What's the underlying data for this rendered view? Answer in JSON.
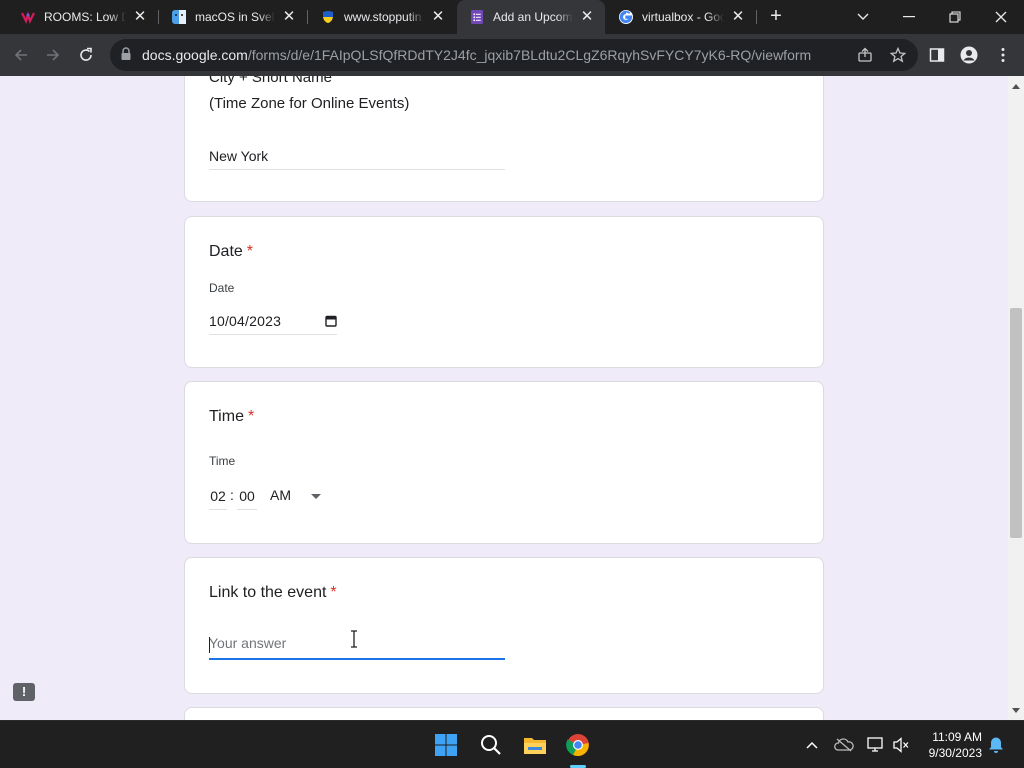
{
  "browser": {
    "tabs": [
      {
        "title": "ROOMS: Low De",
        "favicon": "rooms-logo-icon"
      },
      {
        "title": "macOS in Svelte",
        "favicon": "mac-finder-icon"
      },
      {
        "title": "www.stopputin.",
        "favicon": "ukraine-flag-icon"
      },
      {
        "title": "Add an Upcomi",
        "favicon": "google-forms-icon",
        "active": true
      },
      {
        "title": "virtualbox - Goo",
        "favicon": "google-g-icon"
      }
    ],
    "url_host": "docs.google.com",
    "url_path": "/forms/d/e/1FAIpQLSfQfRDdTY2J4fc_jqxib7BLdtu2CLgZ6RqyhSvFYCY7yK6-RQ/viewform"
  },
  "form": {
    "city_card": {
      "label_line1": "City + Short Name",
      "label_line2": "(Time Zone for Online Events)",
      "value": "New York"
    },
    "date_card": {
      "title": "Date",
      "required_mark": "*",
      "sublabel": "Date",
      "value": "10/04/2023"
    },
    "time_card": {
      "title": "Time",
      "required_mark": "*",
      "sublabel": "Time",
      "hour": "02",
      "separator": ":",
      "minute": "00",
      "ampm": "AM"
    },
    "link_card": {
      "title": "Link to the event",
      "required_mark": "*",
      "placeholder": "Your answer"
    }
  },
  "feedback_label": "!",
  "taskbar": {
    "time": "11:09 AM",
    "date": "9/30/2023"
  },
  "colors": {
    "form_bg": "#f0ebf8",
    "accent": "#1a73e8",
    "required": "#d93025",
    "browser_dark": "#35363a"
  }
}
